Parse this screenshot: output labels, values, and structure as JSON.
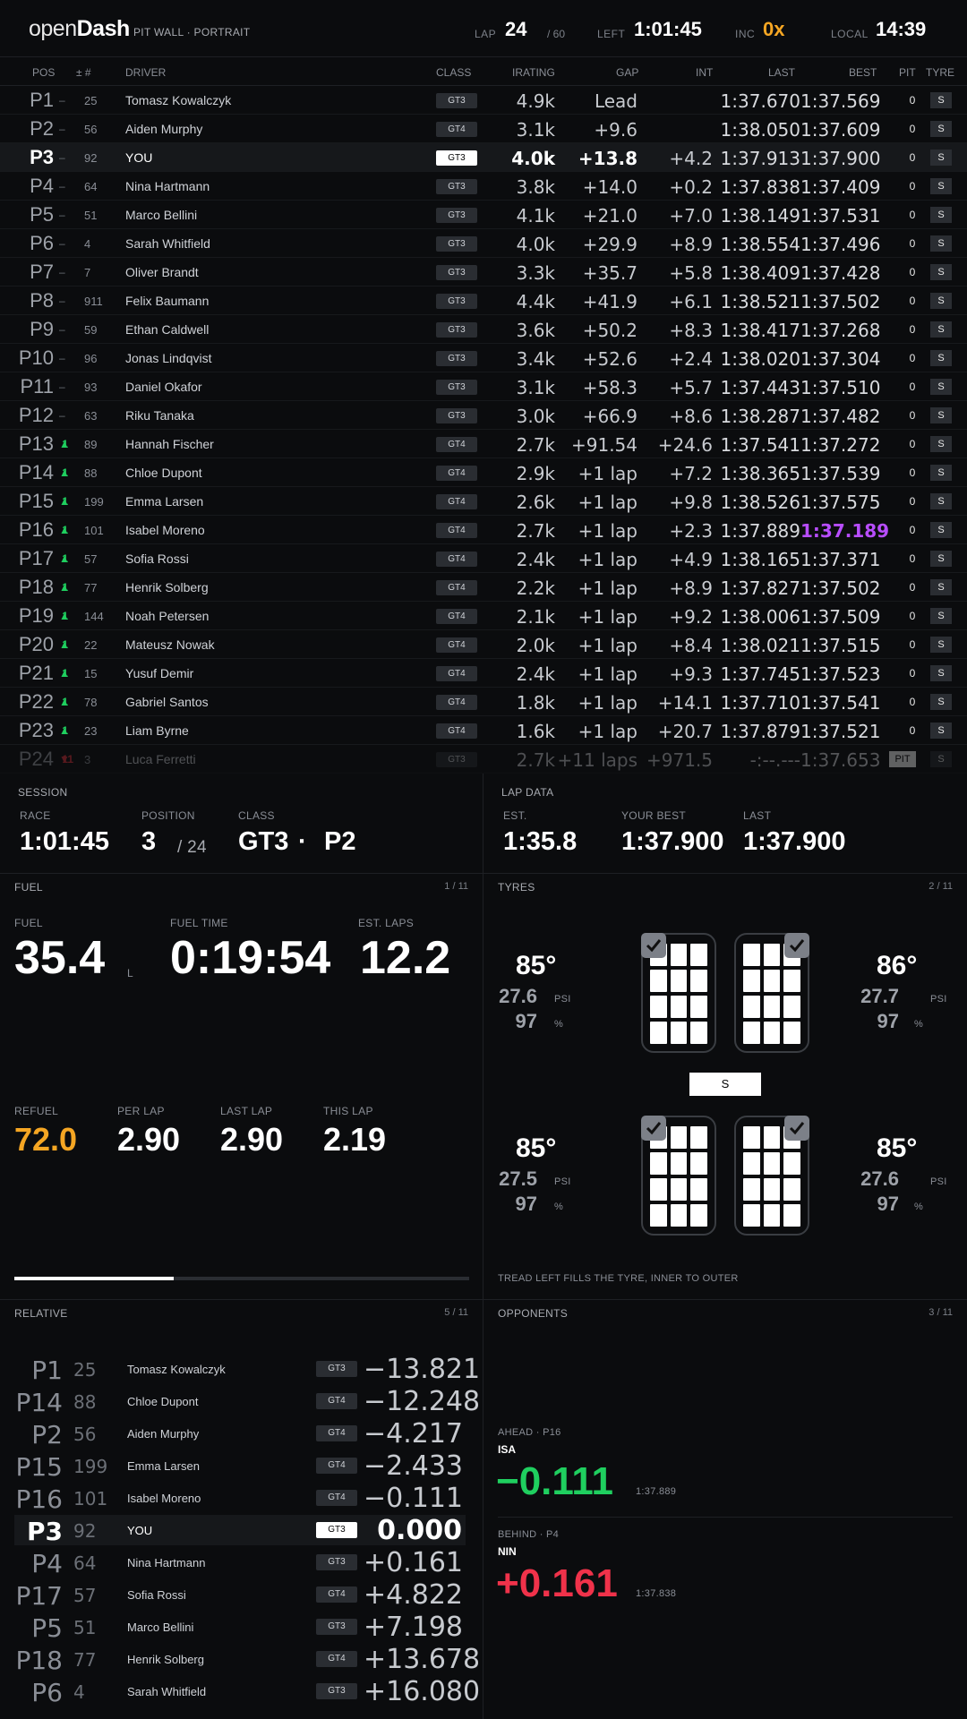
{
  "header": {
    "logo_light": "open",
    "logo_bold": "Dash",
    "subtitle": "PIT WALL · PORTRAIT",
    "lap_label": "LAP",
    "lap_value": "24",
    "lap_total": "/ 60",
    "left_label": "LEFT",
    "left_value": "1:01:45",
    "inc_label": "INC",
    "inc_value": "0x",
    "local_label": "LOCAL",
    "local_value": "14:39",
    "inc_color": "#f5a623"
  },
  "standings": {
    "columns": {
      "pos": "POS",
      "num": "± #",
      "driver": "DRIVER",
      "class": "CLASS",
      "irating": "IRATING",
      "gap": "GAP",
      "int": "INT",
      "last": "LAST",
      "best": "BEST",
      "pit": "PIT",
      "tyre": "TYRE"
    },
    "rows": [
      {
        "pos": "P1",
        "chg": "",
        "chg_dir": "none",
        "num": "25",
        "driver": "Tomasz Kowalczyk",
        "cls": "GT3",
        "ir": "4.9k",
        "gap": "Lead",
        "int": "",
        "last": "1:37.670",
        "best": "1:37.569",
        "pit": "0",
        "tyre": "S"
      },
      {
        "pos": "P2",
        "chg": "",
        "chg_dir": "none",
        "num": "56",
        "driver": "Aiden Murphy",
        "cls": "GT4",
        "ir": "3.1k",
        "gap": "+9.6",
        "int": "",
        "last": "1:38.050",
        "best": "1:37.609",
        "pit": "0",
        "tyre": "S"
      },
      {
        "pos": "P3",
        "chg": "",
        "chg_dir": "none",
        "num": "92",
        "driver": "YOU",
        "cls": "GT3",
        "ir": "4.0k",
        "gap": "+13.8",
        "int": "+4.2",
        "last": "1:37.913",
        "best": "1:37.900",
        "pit": "0",
        "tyre": "S",
        "me": true
      },
      {
        "pos": "P4",
        "chg": "",
        "chg_dir": "none",
        "num": "64",
        "driver": "Nina Hartmann",
        "cls": "GT3",
        "ir": "3.8k",
        "gap": "+14.0",
        "int": "+0.2",
        "last": "1:37.838",
        "best": "1:37.409",
        "pit": "0",
        "tyre": "S"
      },
      {
        "pos": "P5",
        "chg": "",
        "chg_dir": "none",
        "num": "51",
        "driver": "Marco Bellini",
        "cls": "GT3",
        "ir": "4.1k",
        "gap": "+21.0",
        "int": "+7.0",
        "last": "1:38.149",
        "best": "1:37.531",
        "pit": "0",
        "tyre": "S"
      },
      {
        "pos": "P6",
        "chg": "",
        "chg_dir": "none",
        "num": "4",
        "driver": "Sarah Whitfield",
        "cls": "GT3",
        "ir": "4.0k",
        "gap": "+29.9",
        "int": "+8.9",
        "last": "1:38.554",
        "best": "1:37.496",
        "pit": "0",
        "tyre": "S"
      },
      {
        "pos": "P7",
        "chg": "",
        "chg_dir": "none",
        "num": "7",
        "driver": "Oliver Brandt",
        "cls": "GT3",
        "ir": "3.3k",
        "gap": "+35.7",
        "int": "+5.8",
        "last": "1:38.409",
        "best": "1:37.428",
        "pit": "0",
        "tyre": "S"
      },
      {
        "pos": "P8",
        "chg": "",
        "chg_dir": "none",
        "num": "911",
        "driver": "Felix Baumann",
        "cls": "GT3",
        "ir": "4.4k",
        "gap": "+41.9",
        "int": "+6.1",
        "last": "1:38.521",
        "best": "1:37.502",
        "pit": "0",
        "tyre": "S"
      },
      {
        "pos": "P9",
        "chg": "",
        "chg_dir": "none",
        "num": "59",
        "driver": "Ethan Caldwell",
        "cls": "GT3",
        "ir": "3.6k",
        "gap": "+50.2",
        "int": "+8.3",
        "last": "1:38.417",
        "best": "1:37.268",
        "pit": "0",
        "tyre": "S"
      },
      {
        "pos": "P10",
        "chg": "",
        "chg_dir": "none",
        "num": "96",
        "driver": "Jonas Lindqvist",
        "cls": "GT3",
        "ir": "3.4k",
        "gap": "+52.6",
        "int": "+2.4",
        "last": "1:38.020",
        "best": "1:37.304",
        "pit": "0",
        "tyre": "S"
      },
      {
        "pos": "P11",
        "chg": "",
        "chg_dir": "none",
        "num": "93",
        "driver": "Daniel Okafor",
        "cls": "GT3",
        "ir": "3.1k",
        "gap": "+58.3",
        "int": "+5.7",
        "last": "1:37.443",
        "best": "1:37.510",
        "pit": "0",
        "tyre": "S"
      },
      {
        "pos": "P12",
        "chg": "",
        "chg_dir": "none",
        "num": "63",
        "driver": "Riku Tanaka",
        "cls": "GT3",
        "ir": "3.0k",
        "gap": "+66.9",
        "int": "+8.6",
        "last": "1:38.287",
        "best": "1:37.482",
        "pit": "0",
        "tyre": "S"
      },
      {
        "pos": "P13",
        "chg": "1",
        "chg_dir": "up",
        "num": "89",
        "driver": "Hannah Fischer",
        "cls": "GT4",
        "ir": "2.7k",
        "gap": "+91.54",
        "int": "+24.6",
        "last": "1:37.541",
        "best": "1:37.272",
        "pit": "0",
        "tyre": "S"
      },
      {
        "pos": "P14",
        "chg": "1",
        "chg_dir": "up",
        "num": "88",
        "driver": "Chloe Dupont",
        "cls": "GT4",
        "ir": "2.9k",
        "gap": "+1 lap",
        "int": "+7.2",
        "last": "1:38.365",
        "best": "1:37.539",
        "pit": "0",
        "tyre": "S"
      },
      {
        "pos": "P15",
        "chg": "1",
        "chg_dir": "up",
        "num": "199",
        "driver": "Emma Larsen",
        "cls": "GT4",
        "ir": "2.6k",
        "gap": "+1 lap",
        "int": "+9.8",
        "last": "1:38.526",
        "best": "1:37.575",
        "pit": "0",
        "tyre": "S"
      },
      {
        "pos": "P16",
        "chg": "1",
        "chg_dir": "up",
        "num": "101",
        "driver": "Isabel Moreno",
        "cls": "GT4",
        "ir": "2.7k",
        "gap": "+1 lap",
        "int": "+2.3",
        "last": "1:37.889",
        "best": "1:37.189",
        "pit": "0",
        "tyre": "S",
        "best_purple": true
      },
      {
        "pos": "P17",
        "chg": "1",
        "chg_dir": "up",
        "num": "57",
        "driver": "Sofia Rossi",
        "cls": "GT4",
        "ir": "2.4k",
        "gap": "+1 lap",
        "int": "+4.9",
        "last": "1:38.165",
        "best": "1:37.371",
        "pit": "0",
        "tyre": "S"
      },
      {
        "pos": "P18",
        "chg": "1",
        "chg_dir": "up",
        "num": "77",
        "driver": "Henrik Solberg",
        "cls": "GT4",
        "ir": "2.2k",
        "gap": "+1 lap",
        "int": "+8.9",
        "last": "1:37.827",
        "best": "1:37.502",
        "pit": "0",
        "tyre": "S"
      },
      {
        "pos": "P19",
        "chg": "1",
        "chg_dir": "up",
        "num": "144",
        "driver": "Noah Petersen",
        "cls": "GT4",
        "ir": "2.1k",
        "gap": "+1 lap",
        "int": "+9.2",
        "last": "1:38.006",
        "best": "1:37.509",
        "pit": "0",
        "tyre": "S"
      },
      {
        "pos": "P20",
        "chg": "1",
        "chg_dir": "up",
        "num": "22",
        "driver": "Mateusz Nowak",
        "cls": "GT4",
        "ir": "2.0k",
        "gap": "+1 lap",
        "int": "+8.4",
        "last": "1:38.021",
        "best": "1:37.515",
        "pit": "0",
        "tyre": "S"
      },
      {
        "pos": "P21",
        "chg": "1",
        "chg_dir": "up",
        "num": "15",
        "driver": "Yusuf Demir",
        "cls": "GT4",
        "ir": "2.4k",
        "gap": "+1 lap",
        "int": "+9.3",
        "last": "1:37.745",
        "best": "1:37.523",
        "pit": "0",
        "tyre": "S"
      },
      {
        "pos": "P22",
        "chg": "1",
        "chg_dir": "up",
        "num": "78",
        "driver": "Gabriel Santos",
        "cls": "GT4",
        "ir": "1.8k",
        "gap": "+1 lap",
        "int": "+14.1",
        "last": "1:37.710",
        "best": "1:37.541",
        "pit": "0",
        "tyre": "S"
      },
      {
        "pos": "P23",
        "chg": "1",
        "chg_dir": "up",
        "num": "23",
        "driver": "Liam Byrne",
        "cls": "GT4",
        "ir": "1.6k",
        "gap": "+1 lap",
        "int": "+20.7",
        "last": "1:37.879",
        "best": "1:37.521",
        "pit": "0",
        "tyre": "S"
      },
      {
        "pos": "P24",
        "chg": "11",
        "chg_dir": "down",
        "num": "3",
        "driver": "Luca Ferretti",
        "cls": "GT3",
        "ir": "2.7k",
        "gap": "+11 laps",
        "int": "+971.5",
        "last": "-:--.---",
        "best": "1:37.653",
        "pit": "PIT",
        "tyre": "S",
        "dim": true
      }
    ]
  },
  "session": {
    "label": "SESSION",
    "race_label": "RACE",
    "race_value": "1:01:45",
    "position_label": "POSITION",
    "position_value": "3",
    "position_total": "/ 24",
    "class_label": "CLASS",
    "class_value": "GT3",
    "class_sep": "·",
    "class_pos": "P2"
  },
  "lapdata": {
    "label": "LAP DATA",
    "est_label": "EST.",
    "est_value": "1:35.8",
    "best_label": "YOUR BEST",
    "best_value": "1:37.900",
    "last_label": "LAST",
    "last_value": "1:37.900"
  },
  "fuel": {
    "label": "FUEL",
    "count": "1 / 11",
    "fuel_label": "FUEL",
    "fuel_value": "35.4",
    "fuel_unit": "L",
    "time_label": "FUEL TIME",
    "time_value": "0:19:54",
    "laps_label": "EST. LAPS",
    "laps_value": "12.2",
    "refuel_label": "REFUEL",
    "refuel_value": "72.0",
    "perlap_label": "PER LAP",
    "perlap_value": "2.90",
    "lastlap_label": "LAST LAP",
    "lastlap_value": "2.90",
    "thislap_label": "THIS LAP",
    "thislap_value": "2.19",
    "progress": 0.35,
    "refuel_color": "#f5a623"
  },
  "tyres": {
    "label": "TYRES",
    "count": "2 / 11",
    "compound": "S",
    "note": "TREAD LEFT FILLS THE TYRE, INNER TO OUTER",
    "psi_unit": "PSI",
    "pct_unit": "%",
    "fl": {
      "temp": "85°",
      "psi": "27.6",
      "pct": "97"
    },
    "fr": {
      "temp": "86°",
      "psi": "27.7",
      "pct": "97"
    },
    "rl": {
      "temp": "85°",
      "psi": "27.5",
      "pct": "97"
    },
    "rr": {
      "temp": "85°",
      "psi": "27.6",
      "pct": "97"
    }
  },
  "relative": {
    "label": "RELATIVE",
    "count": "5 / 11",
    "rows": [
      {
        "pos": "P1",
        "num": "25",
        "driver": "Tomasz Kowalczyk",
        "cls": "GT3",
        "delta": "−13.821"
      },
      {
        "pos": "P14",
        "num": "88",
        "driver": "Chloe Dupont",
        "cls": "GT4",
        "delta": "−12.248"
      },
      {
        "pos": "P2",
        "num": "56",
        "driver": "Aiden Murphy",
        "cls": "GT4",
        "delta": "−4.217"
      },
      {
        "pos": "P15",
        "num": "199",
        "driver": "Emma Larsen",
        "cls": "GT4",
        "delta": "−2.433"
      },
      {
        "pos": "P16",
        "num": "101",
        "driver": "Isabel Moreno",
        "cls": "GT4",
        "delta": "−0.111"
      },
      {
        "pos": "P3",
        "num": "92",
        "driver": "YOU",
        "cls": "GT3",
        "delta": "0.000",
        "me": true
      },
      {
        "pos": "P4",
        "num": "64",
        "driver": "Nina Hartmann",
        "cls": "GT3",
        "delta": "+0.161"
      },
      {
        "pos": "P17",
        "num": "57",
        "driver": "Sofia Rossi",
        "cls": "GT4",
        "delta": "+4.822"
      },
      {
        "pos": "P5",
        "num": "51",
        "driver": "Marco Bellini",
        "cls": "GT3",
        "delta": "+7.198"
      },
      {
        "pos": "P18",
        "num": "77",
        "driver": "Henrik Solberg",
        "cls": "GT4",
        "delta": "+13.678"
      },
      {
        "pos": "P6",
        "num": "4",
        "driver": "Sarah Whitfield",
        "cls": "GT3",
        "delta": "+16.080"
      }
    ]
  },
  "opponents": {
    "label": "OPPONENTS",
    "count": "3 / 11",
    "ahead_label": "AHEAD · P16",
    "ahead_code": "ISA",
    "ahead_delta": "−0.111",
    "ahead_lap": "1:37.889",
    "behind_label": "BEHIND · P4",
    "behind_code": "NIN",
    "behind_delta": "+0.161",
    "behind_lap": "1:37.838",
    "ahead_color": "#1fcf5f",
    "behind_color": "#f0324a"
  }
}
